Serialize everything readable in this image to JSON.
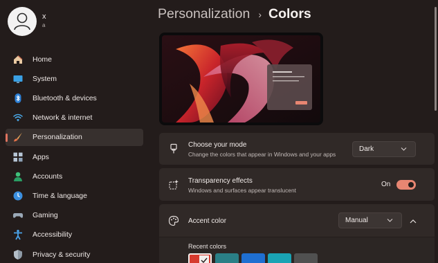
{
  "user": {
    "name": "x",
    "email": "a"
  },
  "nav": [
    {
      "label": "Home",
      "icon": "home-icon"
    },
    {
      "label": "System",
      "icon": "system-icon"
    },
    {
      "label": "Bluetooth & devices",
      "icon": "bluetooth-icon"
    },
    {
      "label": "Network & internet",
      "icon": "network-icon"
    },
    {
      "label": "Personalization",
      "icon": "brush-icon",
      "active": true
    },
    {
      "label": "Apps",
      "icon": "apps-icon"
    },
    {
      "label": "Accounts",
      "icon": "accounts-icon"
    },
    {
      "label": "Time & language",
      "icon": "time-language-icon"
    },
    {
      "label": "Gaming",
      "icon": "gaming-icon"
    },
    {
      "label": "Accessibility",
      "icon": "accessibility-icon"
    },
    {
      "label": "Privacy & security",
      "icon": "shield-icon"
    }
  ],
  "breadcrumb": {
    "parent": "Personalization",
    "separator": "›",
    "current": "Colors"
  },
  "mode": {
    "title": "Choose your mode",
    "desc": "Change the colors that appear in Windows and your apps",
    "value": "Dark"
  },
  "transparency": {
    "title": "Transparency effects",
    "desc": "Windows and surfaces appear translucent",
    "state_label": "On",
    "on": true
  },
  "accent": {
    "title": "Accent color",
    "value": "Manual",
    "recent_label": "Recent colors",
    "recent_colors": [
      "#d63a2e",
      "#2a7f86",
      "#1f6fd1",
      "#1aa3b4",
      "#505050"
    ]
  },
  "colors": {
    "accent": "#e88672",
    "background": "#231c1b",
    "card": "#302927"
  }
}
